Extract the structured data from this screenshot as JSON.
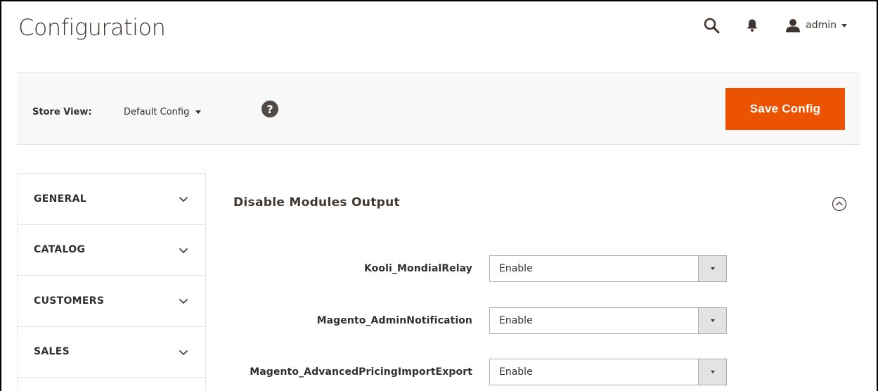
{
  "header": {
    "page_title": "Configuration",
    "user_name": "admin"
  },
  "store_bar": {
    "label": "Store View:",
    "selected_scope": "Default Config",
    "help_icon": "?",
    "save_label": "Save Config"
  },
  "sidebar": {
    "items": [
      {
        "label": "GENERAL"
      },
      {
        "label": "CATALOG"
      },
      {
        "label": "CUSTOMERS"
      },
      {
        "label": "SALES"
      }
    ]
  },
  "section": {
    "title": "Disable Modules Output",
    "rows": [
      {
        "module": "Kooli_MondialRelay",
        "value": "Enable"
      },
      {
        "module": "Magento_AdminNotification",
        "value": "Enable"
      },
      {
        "module": "Magento_AdvancedPricingImportExport",
        "value": "Enable"
      }
    ]
  },
  "colors": {
    "accent": "#eb5202",
    "header_text": "#41362f",
    "bar_background": "#f8f8f8",
    "border": "#e3e3e3"
  },
  "icons": {
    "search": "search-icon",
    "notifications": "bell-icon",
    "user": "user-icon",
    "help": "help-icon",
    "collapse": "collapse-up-circle-icon",
    "expand": "chevron-down-icon"
  }
}
